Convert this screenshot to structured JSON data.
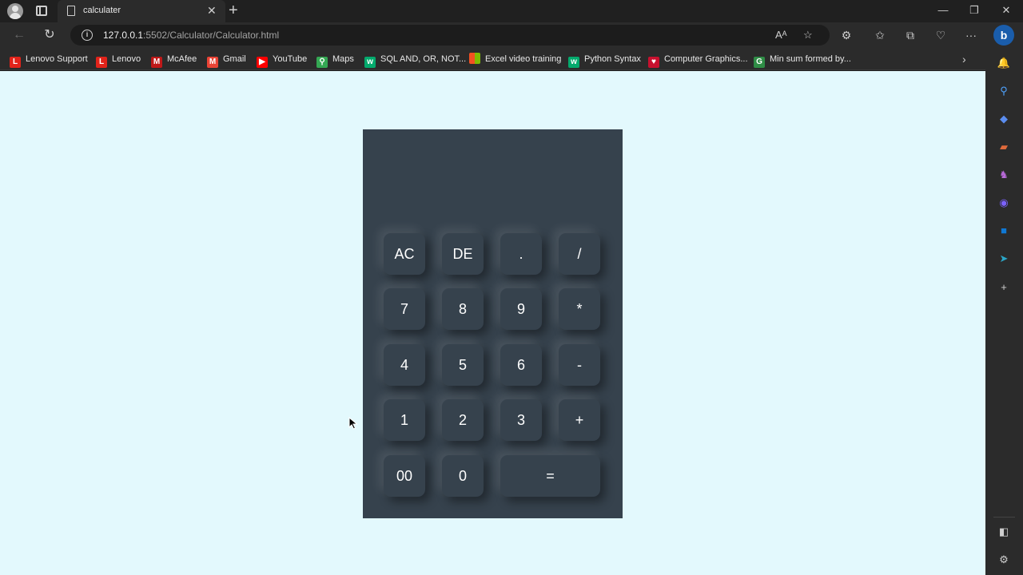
{
  "browser": {
    "tab_title": "calculater",
    "url_host": "127.0.0.1",
    "url_rest": ":5502/Calculator/Calculator.html",
    "favorites": [
      {
        "label": "Lenovo Support",
        "icon": "lenovo-icon",
        "color": "#e2231a"
      },
      {
        "label": "Lenovo",
        "icon": "lenovo-icon",
        "color": "#e2231a"
      },
      {
        "label": "McAfee",
        "icon": "mcafee-icon",
        "color": "#c01818"
      },
      {
        "label": "Gmail",
        "icon": "gmail-icon",
        "color": "#ea4335"
      },
      {
        "label": "YouTube",
        "icon": "youtube-icon",
        "color": "#ff0000"
      },
      {
        "label": "Maps",
        "icon": "maps-icon",
        "color": "#34a853"
      },
      {
        "label": "SQL AND, OR, NOT...",
        "icon": "w3schools-icon",
        "color": "#04aa6d"
      },
      {
        "label": "Excel video training",
        "icon": "microsoft-icon",
        "color": "#f25022"
      },
      {
        "label": "Python Syntax",
        "icon": "w3schools-icon",
        "color": "#04aa6d"
      },
      {
        "label": "Computer Graphics...",
        "icon": "heart-icon",
        "color": "#c8102e"
      },
      {
        "label": "Min sum formed by...",
        "icon": "geeksforgeeks-icon",
        "color": "#2f8d46"
      }
    ]
  },
  "calculator": {
    "display": "",
    "keys": [
      {
        "label": "AC"
      },
      {
        "label": "DE"
      },
      {
        "label": "."
      },
      {
        "label": "/"
      },
      {
        "label": "7"
      },
      {
        "label": "8"
      },
      {
        "label": "9"
      },
      {
        "label": "*"
      },
      {
        "label": "4"
      },
      {
        "label": "5"
      },
      {
        "label": "6"
      },
      {
        "label": "-"
      },
      {
        "label": "1"
      },
      {
        "label": "2"
      },
      {
        "label": "3"
      },
      {
        "label": "+"
      },
      {
        "label": "00"
      },
      {
        "label": "0"
      },
      {
        "label": "="
      }
    ]
  },
  "colors": {
    "page_background": "#e3f9fd",
    "calculator_body": "#36424d",
    "key_text": "#ffffff"
  }
}
